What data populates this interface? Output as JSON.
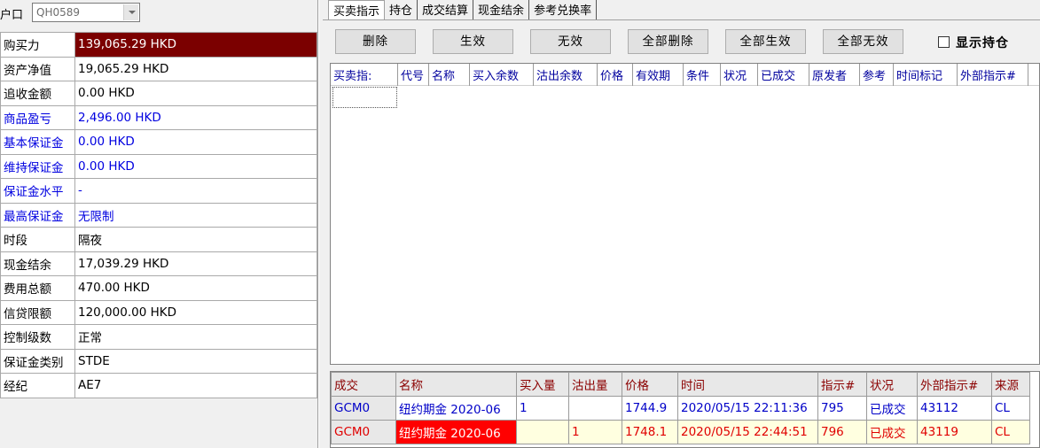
{
  "account": {
    "label": "户口",
    "value": "QH0589"
  },
  "info_rows": [
    {
      "key": "购买力",
      "value": "139,065.29 HKD",
      "style": "sel"
    },
    {
      "key": "资产净值",
      "value": "19,065.29 HKD",
      "style": ""
    },
    {
      "key": "追收金额",
      "value": "0.00 HKD",
      "style": ""
    },
    {
      "key": "商品盈亏",
      "value": "2,496.00 HKD",
      "style": "blue"
    },
    {
      "key": "基本保证金",
      "value": "0.00 HKD",
      "style": "blue"
    },
    {
      "key": "维持保证金",
      "value": "0.00 HKD",
      "style": "blue"
    },
    {
      "key": "保证金水平",
      "value": "-",
      "style": "blue"
    },
    {
      "key": "最高保证金",
      "value": "无限制",
      "style": "blue"
    },
    {
      "key": "时段",
      "value": "隔夜",
      "style": ""
    },
    {
      "key": "现金结余",
      "value": "17,039.29 HKD",
      "style": ""
    },
    {
      "key": "费用总额",
      "value": "470.00 HKD",
      "style": ""
    },
    {
      "key": "信贷限额",
      "value": "120,000.00 HKD",
      "style": ""
    },
    {
      "key": "控制级数",
      "value": "正常",
      "style": ""
    },
    {
      "key": "保证金类别",
      "value": "STDE",
      "style": ""
    },
    {
      "key": "经纪",
      "value": "AE7",
      "style": ""
    }
  ],
  "tabs": [
    "买卖指示",
    "持仓",
    "成交结算",
    "现金结余",
    "参考兑换率"
  ],
  "active_tab": 0,
  "toolbar": {
    "delete": "删除",
    "activate": "生效",
    "deactivate": "无效",
    "delete_all": "全部删除",
    "activate_all": "全部生效",
    "deactivate_all": "全部无效",
    "show_positions": "显示持仓"
  },
  "order_columns": [
    "买卖指:",
    "代号",
    "名称",
    "买入余数",
    "沽出余数",
    "价格",
    "有效期",
    "条件",
    "状况",
    "已成交",
    "原发者",
    "参考",
    "时间标记",
    "外部指示#"
  ],
  "trade_columns": [
    "成交",
    "名称",
    "买入量",
    "沽出量",
    "价格",
    "时间",
    "指示#",
    "状况",
    "外部指示#",
    "来源"
  ],
  "trades": [
    {
      "side": "buy",
      "cells": [
        "GCM0",
        "纽约期金 2020-06",
        "1",
        "",
        "1744.9",
        "2020/05/15 22:11:36",
        "795",
        "已成交",
        "43112",
        "CL"
      ]
    },
    {
      "side": "sell",
      "cells": [
        "GCM0",
        "纽约期金 2020-06",
        "",
        "1",
        "1748.1",
        "2020/05/15 22:44:51",
        "796",
        "已成交",
        "43119",
        "CL"
      ]
    }
  ],
  "colors": {
    "selected_row": "#7b0000",
    "blue_text": "#0000e0",
    "header_text": "#8b0000",
    "sell_text": "#e00000",
    "buy_text": "#0000c8",
    "sell_highlight": "#ff0000"
  }
}
